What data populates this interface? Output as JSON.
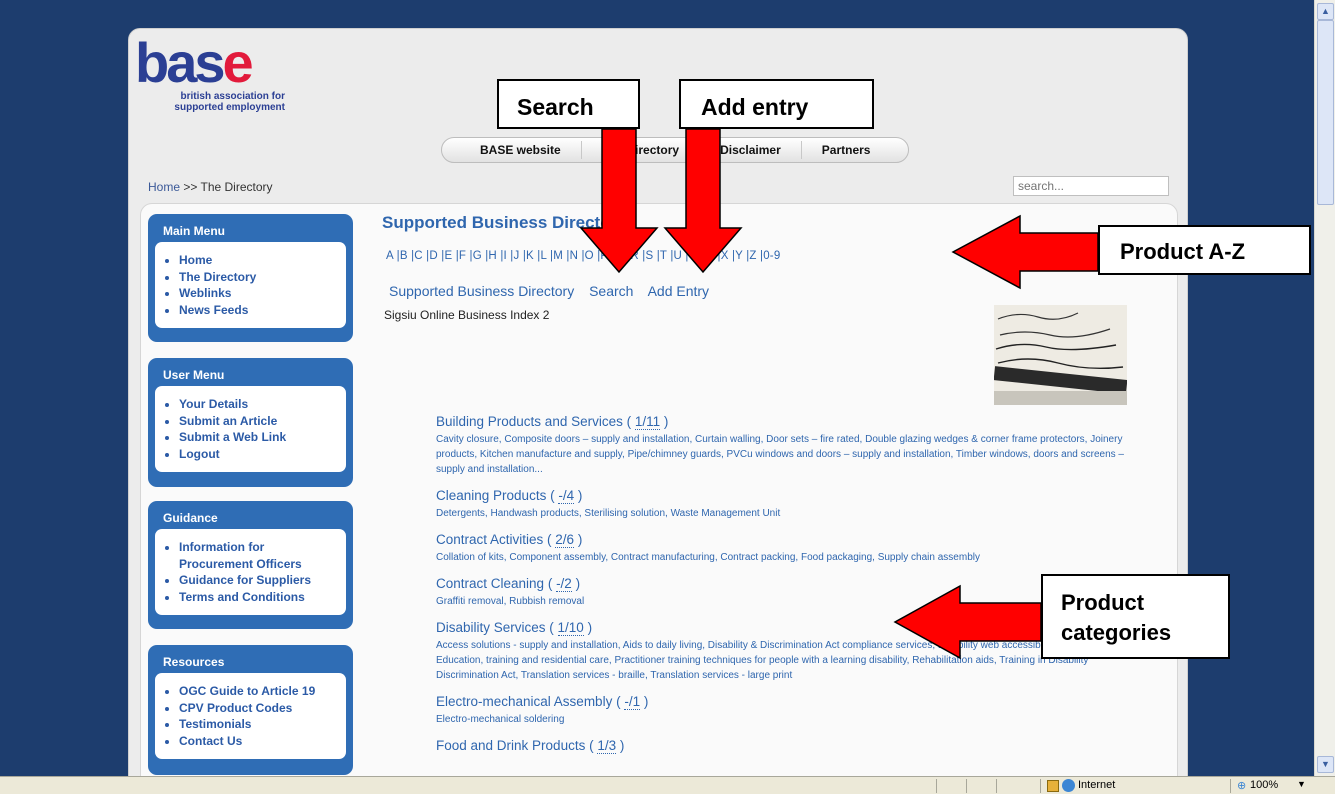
{
  "logo": {
    "word_main": "ba",
    "word_s": "s",
    "word_e": "e",
    "subtitle_line1": "british association for",
    "subtitle_line2": "supported employment"
  },
  "topnav": [
    "BASE website",
    "The Directory",
    "Disclaimer",
    "Partners"
  ],
  "breadcrumb": {
    "home": "Home",
    "sep": ">>",
    "current": "The Directory"
  },
  "search": {
    "placeholder": "search..."
  },
  "modules": [
    {
      "title": "Main Menu",
      "items": [
        "Home",
        "The Directory",
        "Weblinks",
        "News Feeds"
      ]
    },
    {
      "title": "User Menu",
      "items": [
        "Your Details",
        "Submit an Article",
        "Submit a Web Link",
        "Logout"
      ]
    },
    {
      "title": "Guidance",
      "items": [
        "Information for Procurement Officers",
        "Guidance for Suppliers",
        "Terms and Conditions"
      ]
    },
    {
      "title": "Resources",
      "items": [
        "OGC Guide to Article 19",
        "CPV Product Codes",
        "Testimonials",
        "Contact Us"
      ]
    }
  ],
  "main": {
    "title": "Supported Business Directory",
    "az": "A |B |C |D |E |F |G |H |I |J |K |L |M |N |O |P |Q |R |S |T |U |V |W |X |Y |Z |0-9",
    "subnav": [
      "Supported Business Directory",
      "Search",
      "Add Entry"
    ],
    "index_label": "Sigsiu Online Business Index 2"
  },
  "categories": [
    {
      "name": "Building Products and Services",
      "count": "1/11",
      "desc": "Cavity closure, Composite doors – supply and installation, Curtain walling, Door sets – fire rated, Double glazing wedges & corner frame protectors, Joinery products, Kitchen manufacture and supply, Pipe/chimney guards, PVCu windows and doors – supply and installation, Timber windows, doors and screens – supply and installation..."
    },
    {
      "name": "Cleaning Products",
      "count": "-/4",
      "desc": "Detergents, Handwash products, Sterilising solution, Waste Management Unit"
    },
    {
      "name": "Contract Activities",
      "count": "2/6",
      "desc": "Collation of kits, Component assembly, Contract manufacturing, Contract packing, Food packaging, Supply chain assembly"
    },
    {
      "name": "Contract Cleaning",
      "count": "-/2",
      "desc": "Graffiti removal, Rubbish removal"
    },
    {
      "name": "Disability Services",
      "count": "1/10",
      "desc": "Access solutions - supply and installation, Aids to daily living, Disability & Discrimination Act compliance services, Disability web accessibility testing, Education, training and residential care, Practitioner training techniques for people with a learning disability, Rehabilitation aids, Training in Disability Discrimination Act, Translation services - braille, Translation services - large print"
    },
    {
      "name": "Electro-mechanical Assembly",
      "count": "-/1",
      "desc": "Electro-mechanical soldering"
    },
    {
      "name": "Food and Drink Products",
      "count": "1/3",
      "desc": ""
    }
  ],
  "annotations": {
    "search": "Search",
    "add_entry": "Add entry",
    "product_az": "Product A-Z",
    "product_categories_1": "Product",
    "product_categories_2": "categories"
  },
  "statusbar": {
    "zone": "Internet",
    "zoom": "100%"
  },
  "colors": {
    "background": "#1d3d6e",
    "module": "#2f6db5",
    "link": "#2f66ae",
    "arrow": "#ff0000"
  }
}
